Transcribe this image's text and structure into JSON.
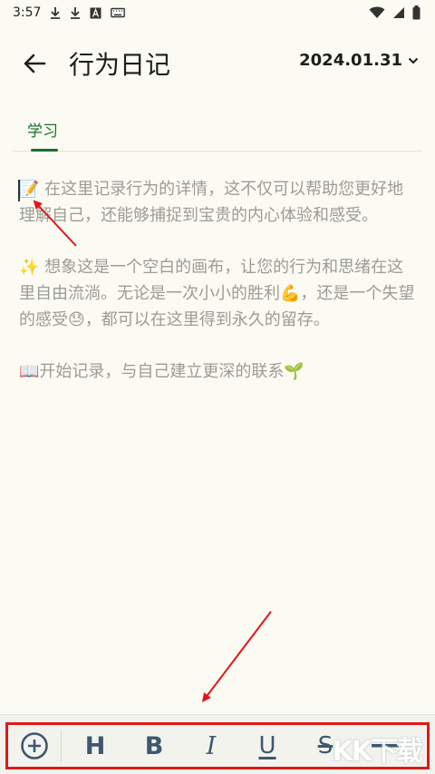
{
  "status_bar": {
    "time": "3:57"
  },
  "header": {
    "title": "行为日记",
    "date": "2024.01.31"
  },
  "tabs": [
    {
      "label": "学习",
      "active": true
    }
  ],
  "editor": {
    "paragraphs": [
      "📝 在这里记录行为的详情，这不仅可以帮助您更好地理解自己，还能够捕捉到宝贵的内心体验和感受。",
      "✨ 想象这是一个空白的画布，让您的行为和思绪在这里自由流淌。无论是一次小小的胜利💪，还是一个失望的感受😓，都可以在这里得到永久的留存。",
      "📖开始记录，与自己建立更深的联系🌱"
    ]
  },
  "toolbar": {
    "heading_label": "H",
    "bold_label": "B",
    "italic_label": "I",
    "underline_label": "U",
    "strike_label": "S"
  },
  "watermark": {
    "text": "KK下载"
  },
  "colors": {
    "accent_green": "#1b6e2e",
    "toolbar_icon": "#3d5870",
    "annotation_red": "#e01818",
    "background": "#fbfaf3"
  }
}
